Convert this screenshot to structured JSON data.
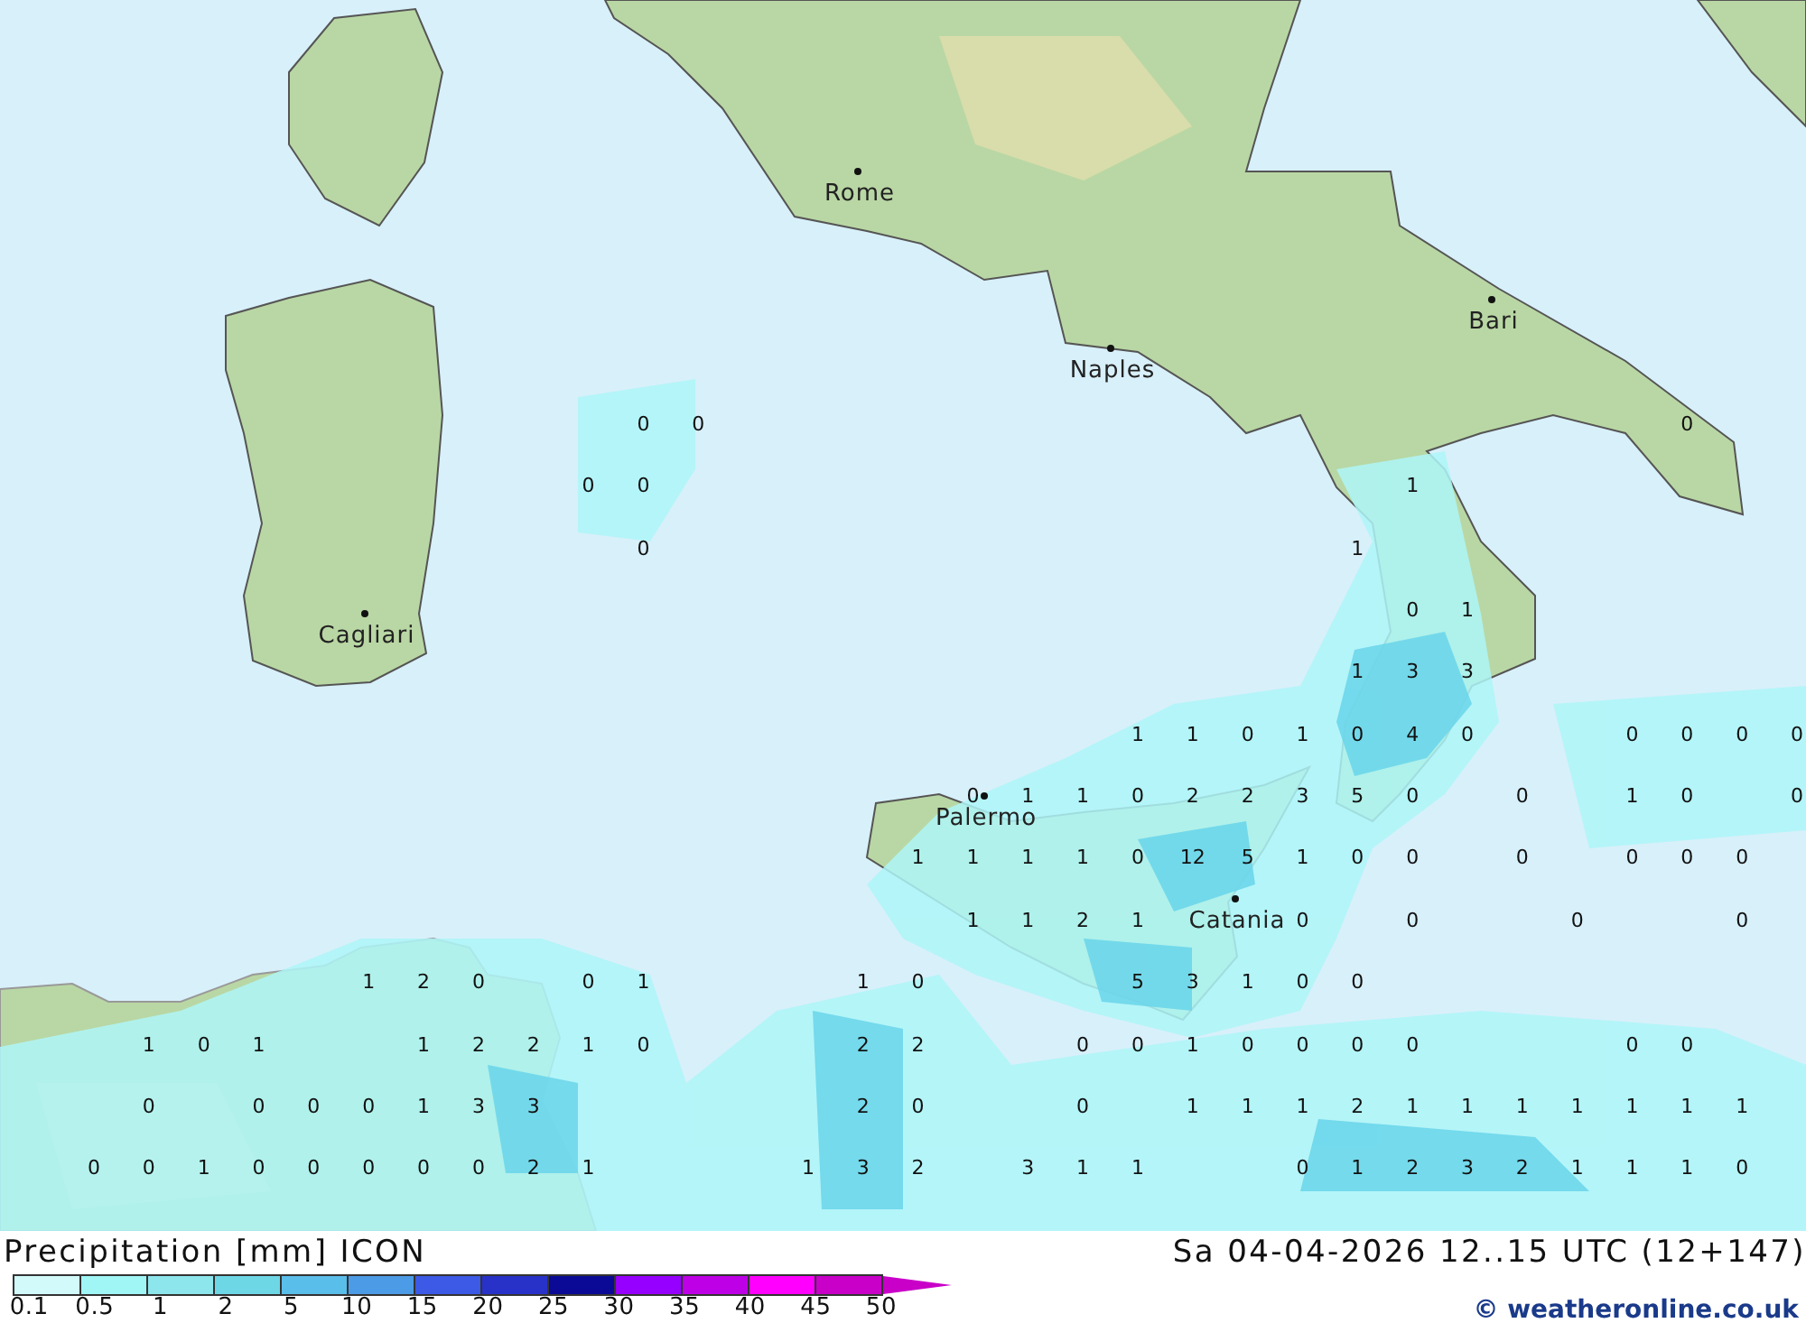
{
  "map": {
    "cities": [
      {
        "name": "Rome"
      },
      {
        "name": "Naples"
      },
      {
        "name": "Bari"
      },
      {
        "name": "Cagliari"
      },
      {
        "name": "Palermo"
      },
      {
        "name": "Catania"
      }
    ],
    "value_rows": [
      [
        "0",
        "0",
        "0"
      ],
      [
        "0",
        "0",
        "1"
      ],
      [
        "0",
        "1"
      ],
      [
        "0",
        "1"
      ],
      [
        "1",
        "3",
        "3"
      ],
      [
        "1",
        "1",
        "0",
        "1",
        "0",
        "4",
        "0",
        "0",
        "0",
        "0",
        "0"
      ],
      [
        "0",
        "1",
        "1",
        "0",
        "2",
        "2",
        "3",
        "5",
        "0",
        "0",
        "1",
        "0",
        "0"
      ],
      [
        "1",
        "1",
        "1",
        "1",
        "0",
        "12",
        "5",
        "1",
        "0",
        "0",
        "0",
        "0",
        "0",
        "0"
      ],
      [
        "1",
        "1",
        "2",
        "1",
        "0",
        "0",
        "0",
        "0"
      ],
      [
        "1",
        "2",
        "0",
        "0",
        "1",
        "1",
        "0",
        "5",
        "3",
        "1",
        "0",
        "0"
      ],
      [
        "1",
        "0",
        "1",
        "1",
        "2",
        "2",
        "1",
        "0",
        "2",
        "2",
        "0",
        "0",
        "1",
        "0",
        "0",
        "0",
        "0",
        "0",
        "0"
      ],
      [
        "0",
        "0",
        "0",
        "0",
        "1",
        "3",
        "3",
        "2",
        "0",
        "0",
        "1",
        "1",
        "1",
        "2",
        "1",
        "1",
        "1",
        "1",
        "1",
        "1",
        "1"
      ],
      [
        "0",
        "0",
        "1",
        "0",
        "0",
        "0",
        "0",
        "0",
        "2",
        "1",
        "1",
        "3",
        "2",
        "3",
        "1",
        "1",
        "0",
        "1",
        "2",
        "3",
        "2",
        "1",
        "1",
        "1",
        "0"
      ]
    ]
  },
  "legend": {
    "title": "Precipitation [mm] ICON",
    "valid_time": "Sa 04-04-2026 12..15 UTC (12+147)",
    "scale_colors": [
      {
        "color": "#d2fafa"
      },
      {
        "color": "#a0f5f5"
      },
      {
        "color": "#8ce6eb"
      },
      {
        "color": "#6ed7e6"
      },
      {
        "color": "#5abeeb"
      },
      {
        "color": "#4b9be6"
      },
      {
        "color": "#3c5ae6"
      },
      {
        "color": "#2832c8"
      },
      {
        "color": "#0a0a96"
      },
      {
        "color": "#9600ff"
      },
      {
        "color": "#be00e6"
      },
      {
        "color": "#ff00ff"
      },
      {
        "color": "#c800c8"
      }
    ],
    "scale_labels": [
      "0.1",
      "0.5",
      "1",
      "2",
      "5",
      "10",
      "15",
      "20",
      "25",
      "30",
      "35",
      "40",
      "45",
      "50"
    ],
    "copyright": "© weatheronline.co.uk"
  }
}
